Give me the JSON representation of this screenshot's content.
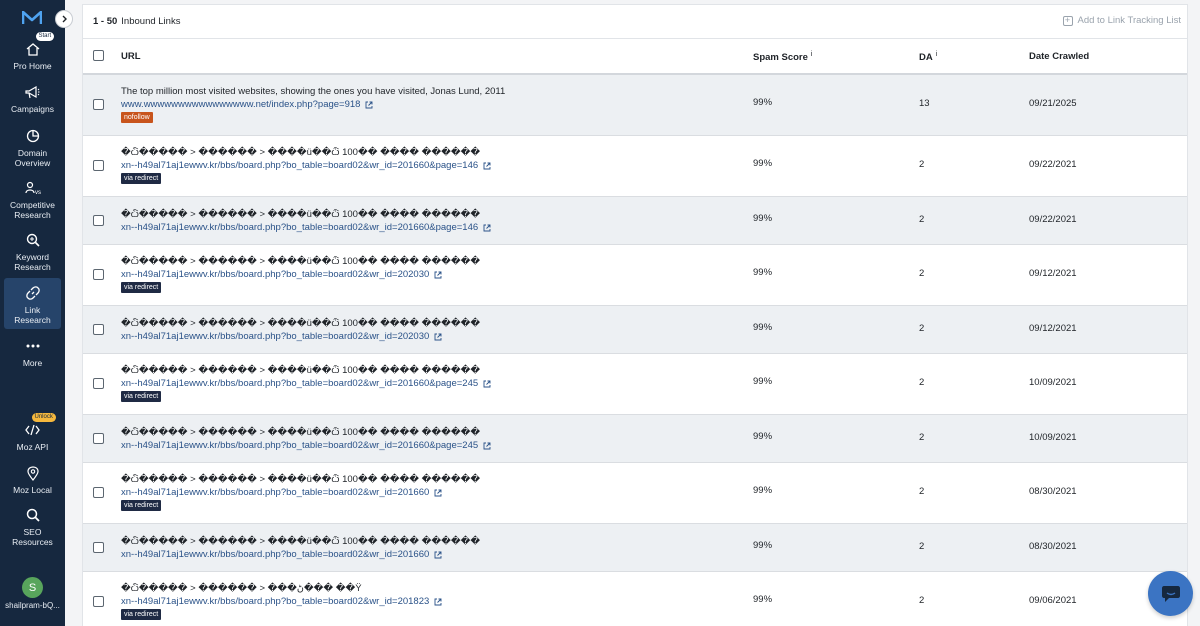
{
  "sidebar": {
    "items": [
      {
        "label_1": "Pro Home",
        "label_2": "",
        "badge": "Start"
      },
      {
        "label_1": "Campaigns",
        "label_2": ""
      },
      {
        "label_1": "Domain",
        "label_2": "Overview"
      },
      {
        "label_1": "Competitive",
        "label_2": "Research"
      },
      {
        "label_1": "Keyword",
        "label_2": "Research"
      },
      {
        "label_1": "Link",
        "label_2": "Research"
      },
      {
        "label_1": "More",
        "label_2": ""
      },
      {
        "label_1": "Moz API",
        "label_2": "",
        "badge": "Unlock"
      },
      {
        "label_1": "Moz Local",
        "label_2": ""
      },
      {
        "label_1": "SEO",
        "label_2": "Resources"
      }
    ],
    "user": {
      "initial": "S",
      "name": "shailpram-bQ..."
    }
  },
  "table": {
    "count": "1 - 50",
    "title": "Inbound Links",
    "add_tracking_label": "Add to Link Tracking List",
    "headers": {
      "url": "URL",
      "spam": "Spam Score",
      "spam_info": "i",
      "da": "DA",
      "da_info": "i",
      "date": "Date Crawled"
    },
    "rows": [
      {
        "title": "The top million most visited websites, showing the ones you have visited, Jonas Lund, 2011",
        "url": "www.wwwwwwwwwwwwwwww.net/index.php?page=918",
        "badge": "nofollow",
        "spam": "99%",
        "da": "13",
        "date": "09/21/2025"
      },
      {
        "title": "�ѽ����� > ������ > ����ü��ѽ 100�� ���� ������",
        "url": "xn--h49al71aj1ewwv.kr/bbs/board.php?bo_table=board02&wr_id=201660&page=146",
        "badge": "via redirect",
        "spam": "99%",
        "da": "2",
        "date": "09/22/2021"
      },
      {
        "title": "�ѽ����� > ������ > ����ü��ѽ 100�� ���� ������",
        "url": "xn--h49al71aj1ewwv.kr/bbs/board.php?bo_table=board02&wr_id=201660&page=146",
        "badge": "",
        "spam": "99%",
        "da": "2",
        "date": "09/22/2021"
      },
      {
        "title": "�ѽ����� > ������ > ����ü��ѽ 100�� ���� ������",
        "url": "xn--h49al71aj1ewwv.kr/bbs/board.php?bo_table=board02&wr_id=202030",
        "badge": "via redirect",
        "spam": "99%",
        "da": "2",
        "date": "09/12/2021"
      },
      {
        "title": "�ѽ����� > ������ > ����ü��ѽ 100�� ���� ������",
        "url": "xn--h49al71aj1ewwv.kr/bbs/board.php?bo_table=board02&wr_id=202030",
        "badge": "",
        "spam": "99%",
        "da": "2",
        "date": "09/12/2021"
      },
      {
        "title": "�ѽ����� > ������ > ����ü��ѽ 100�� ���� ������",
        "url": "xn--h49al71aj1ewwv.kr/bbs/board.php?bo_table=board02&wr_id=201660&page=245",
        "badge": "via redirect",
        "spam": "99%",
        "da": "2",
        "date": "10/09/2021"
      },
      {
        "title": "�ѽ����� > ������ > ����ü��ѽ 100�� ���� ������",
        "url": "xn--h49al71aj1ewwv.kr/bbs/board.php?bo_table=board02&wr_id=201660&page=245",
        "badge": "",
        "spam": "99%",
        "da": "2",
        "date": "10/09/2021"
      },
      {
        "title": "�ѽ����� > ������ > ����ü��ѽ 100�� ���� ������",
        "url": "xn--h49al71aj1ewwv.kr/bbs/board.php?bo_table=board02&wr_id=201660",
        "badge": "via redirect",
        "spam": "99%",
        "da": "2",
        "date": "08/30/2021"
      },
      {
        "title": "�ѽ����� > ������ > ����ü��ѽ 100�� ���� ������",
        "url": "xn--h49al71aj1ewwv.kr/bbs/board.php?bo_table=board02&wr_id=201660",
        "badge": "",
        "spam": "99%",
        "da": "2",
        "date": "08/30/2021"
      },
      {
        "title": "�ѽ����� > ������ > ���ڻ��� ��Ÿ",
        "url": "xn--h49al71aj1ewwv.kr/bbs/board.php?bo_table=board02&wr_id=201823",
        "badge": "via redirect",
        "spam": "99%",
        "da": "2",
        "date": "09/06/2021"
      }
    ]
  },
  "colors": {
    "sidebar": "#16283f",
    "active_nav": "#26446a",
    "link": "#2a5288",
    "nofollow": "#c8541c",
    "redirect": "#1f2a44",
    "chat": "#3b74c3"
  }
}
